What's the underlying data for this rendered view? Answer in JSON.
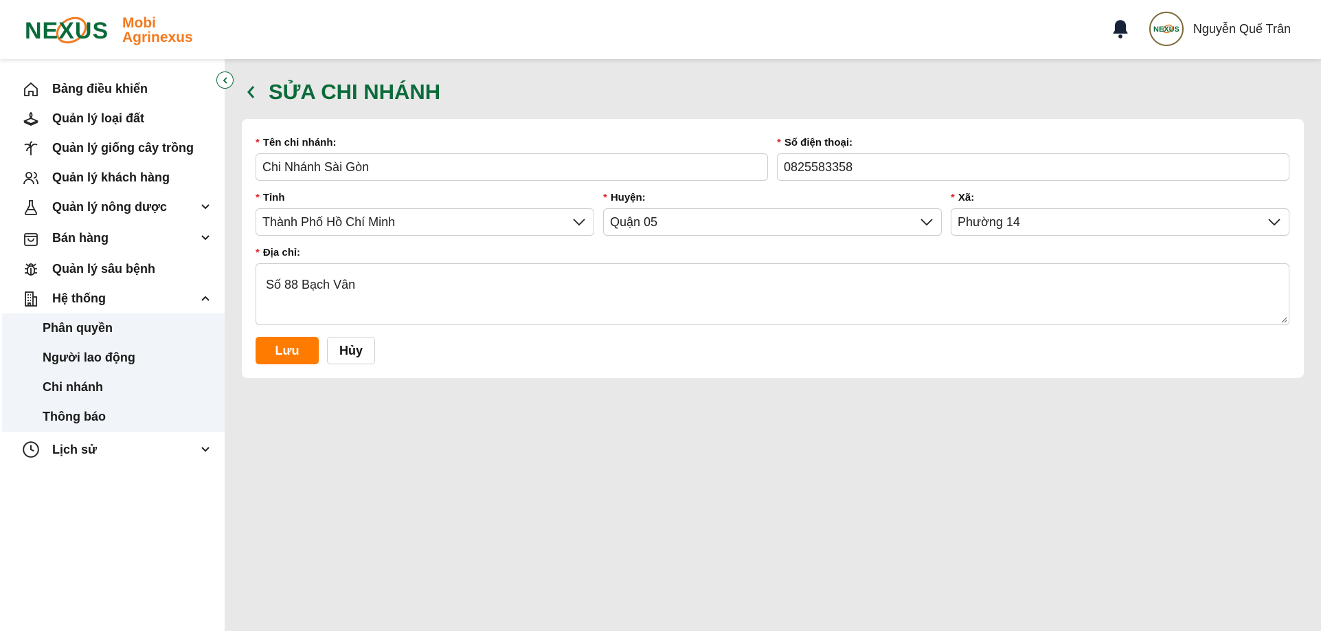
{
  "brand": {
    "logo_word": "NEXUS",
    "line1": "Mobi",
    "line2": "Agrinexus",
    "avatar_word": "NEXUS"
  },
  "header": {
    "user_name": "Nguyễn Quế Trân"
  },
  "sidebar": {
    "items": [
      {
        "label": "Bảng điều khiển",
        "icon": "home-icon"
      },
      {
        "label": "Quản lý loại đất",
        "icon": "soil-icon"
      },
      {
        "label": "Quản lý giống cây trồng",
        "icon": "palm-tree-icon"
      },
      {
        "label": "Quản lý khách hàng",
        "icon": "users-icon"
      },
      {
        "label": "Quản lý nông dược",
        "icon": "flask-icon"
      },
      {
        "label": "Bán hàng",
        "icon": "shopping-bag-icon"
      },
      {
        "label": "Quản lý sâu bệnh",
        "icon": "bug-icon"
      },
      {
        "label": "Hệ thống",
        "icon": "building-icon"
      },
      {
        "label": "Lịch sử",
        "icon": "clock-icon"
      }
    ],
    "submenu": [
      "Phân quyền",
      "Người lao động",
      "Chi nhánh",
      "Thông báo"
    ]
  },
  "page": {
    "title": "SỬA CHI NHÁNH"
  },
  "form": {
    "name_label": "Tên chi nhánh:",
    "name_value": "Chi Nhánh Sài Gòn",
    "phone_label": "Số điện thoại:",
    "phone_value": "0825583358",
    "province_label": "Tỉnh",
    "province_value": "Thành Phố Hồ Chí Minh",
    "district_label": "Huyện:",
    "district_value": "Quận 05",
    "ward_label": "Xã:",
    "ward_value": "Phường 14",
    "address_label": "Địa chỉ:",
    "address_value": "Số 88 Bạch Vân",
    "required_mark": "*",
    "save_label": "Lưu",
    "cancel_label": "Hủy"
  },
  "colors": {
    "brand_green": "#0b6b3a",
    "brand_orange": "#ff7b00",
    "required_red": "#e0282e"
  }
}
